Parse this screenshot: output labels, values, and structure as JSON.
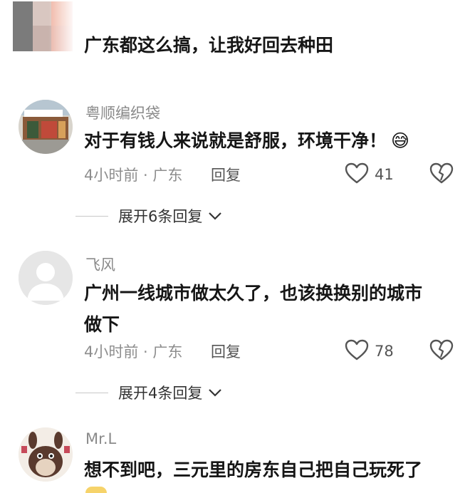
{
  "comments": [
    {
      "username": "",
      "content": "广东都这么搞，让我好回去种田"
    },
    {
      "username": "粤顺编织袋",
      "content": "对于有钱人来说就是舒服，环境干净！",
      "emoji": "😅",
      "time": "4小时前 · 广东",
      "reply_label": "回复",
      "likes": "41",
      "expand_label": "展开6条回复"
    },
    {
      "username": "飞风",
      "content_line1": "广州一线城市做太久了，也该换换别的城市",
      "content_line2": "做下",
      "time": "4小时前 · 广东",
      "reply_label": "回复",
      "likes": "78",
      "expand_label": "展开4条回复"
    },
    {
      "username": "Mr.L",
      "content": "想不到吧，三元里的房东自己把自己玩死了"
    }
  ],
  "colors": {
    "username": "#8a8a8a",
    "content": "#161616",
    "meta": "#8e8e8e",
    "divider": "#c8c8c8"
  }
}
